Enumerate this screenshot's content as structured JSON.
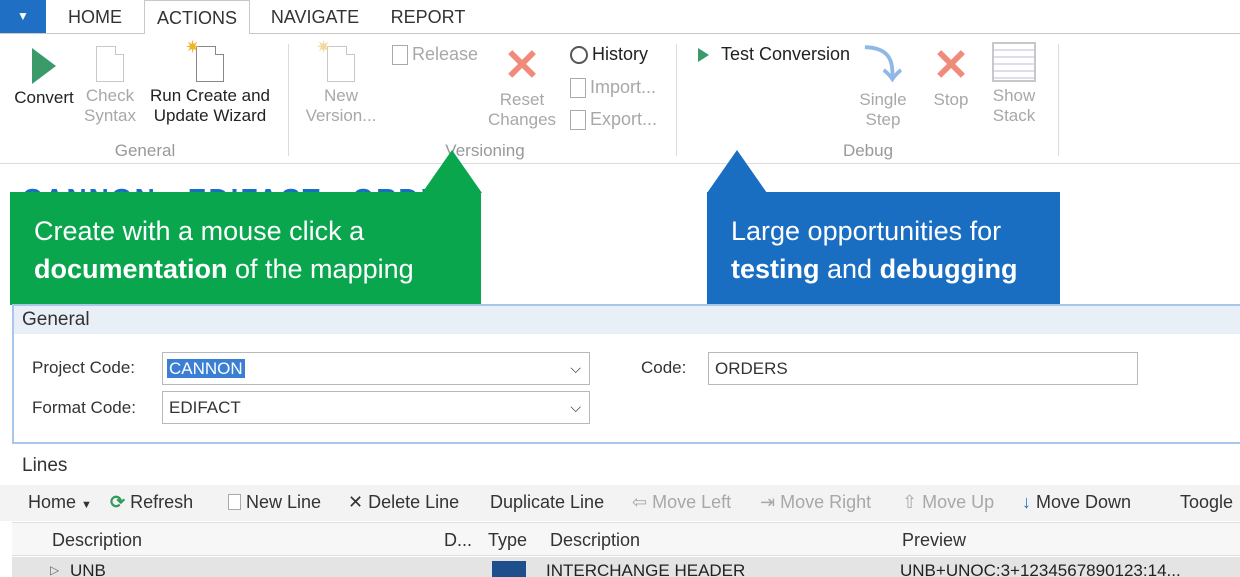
{
  "app_menu_symbol": "▼",
  "tabs": [
    "HOME",
    "ACTIONS",
    "NAVIGATE",
    "REPORT"
  ],
  "ribbon": {
    "convert": "Convert",
    "check_syntax_1": "Check",
    "check_syntax_2": "Syntax",
    "wizard_1": "Run Create and",
    "wizard_2": "Update Wizard",
    "general_label": "General",
    "new_version_1": "New",
    "new_version_2": "Version...",
    "release": "Release",
    "reset_changes_1": "Reset",
    "reset_changes_2": "Changes",
    "history": "History",
    "import": "Import...",
    "export": "Export...",
    "versioning_label": "Versioning",
    "test_conversion": "Test Conversion",
    "single_step_1": "Single",
    "single_step_2": "Step",
    "stop": "Stop",
    "show_stack_1": "Show",
    "show_stack_2": "Stack",
    "debug_label": "Debug"
  },
  "behind_title": "CANNON · EDIFACT · ORDERS",
  "callouts": {
    "green_line1": "Create with a mouse click a",
    "green_bold": "documentation",
    "green_rest": " of the mapping",
    "blue_line1": "Large opportunities for",
    "blue_bold1": "testing",
    "blue_mid": " and ",
    "blue_bold2": "debugging"
  },
  "general": {
    "title": "General",
    "project_code_label": "Project Code:",
    "project_code_value": "CANNON",
    "format_code_label": "Format Code:",
    "format_code_value": "EDIFACT",
    "code_label": "Code:",
    "code_value": "ORDERS"
  },
  "lines": {
    "title": "Lines",
    "toolbar": {
      "home": "Home",
      "refresh": "Refresh",
      "new_line": "New Line",
      "delete_line": "Delete Line",
      "duplicate_line": "Duplicate Line",
      "move_left": "Move Left",
      "move_right": "Move Right",
      "move_up": "Move Up",
      "move_down": "Move Down",
      "toggle": "Toogle"
    },
    "columns": [
      "Description",
      "D...",
      "Type",
      "Description",
      "Preview"
    ],
    "rows": [
      {
        "description": "UNB",
        "type_description": "INTERCHANGE HEADER",
        "preview": "UNB+UNOC:3+1234567890123:14..."
      }
    ]
  },
  "colors": {
    "green_callout": "#0aa64e",
    "blue_callout": "#1a6ec2",
    "accent": "#1f6fc5"
  }
}
